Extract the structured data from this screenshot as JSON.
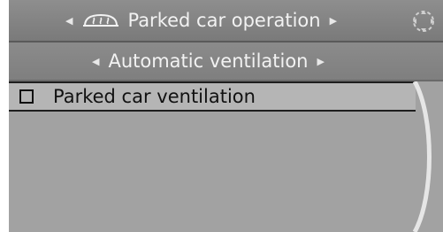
{
  "header": {
    "title": "Parked car operation",
    "icon": "parked-car-heat-icon"
  },
  "submenu": {
    "title": "Automatic ventilation"
  },
  "options": [
    {
      "label": "Parked car ventilation",
      "checked": false
    }
  ],
  "controller": {
    "icon": "idrive-controller-icon"
  },
  "colors": {
    "screen_bg": "#a2a2a2",
    "header_bg": "#858585",
    "text_light": "#f2f2f2",
    "text_dark": "#111111"
  }
}
